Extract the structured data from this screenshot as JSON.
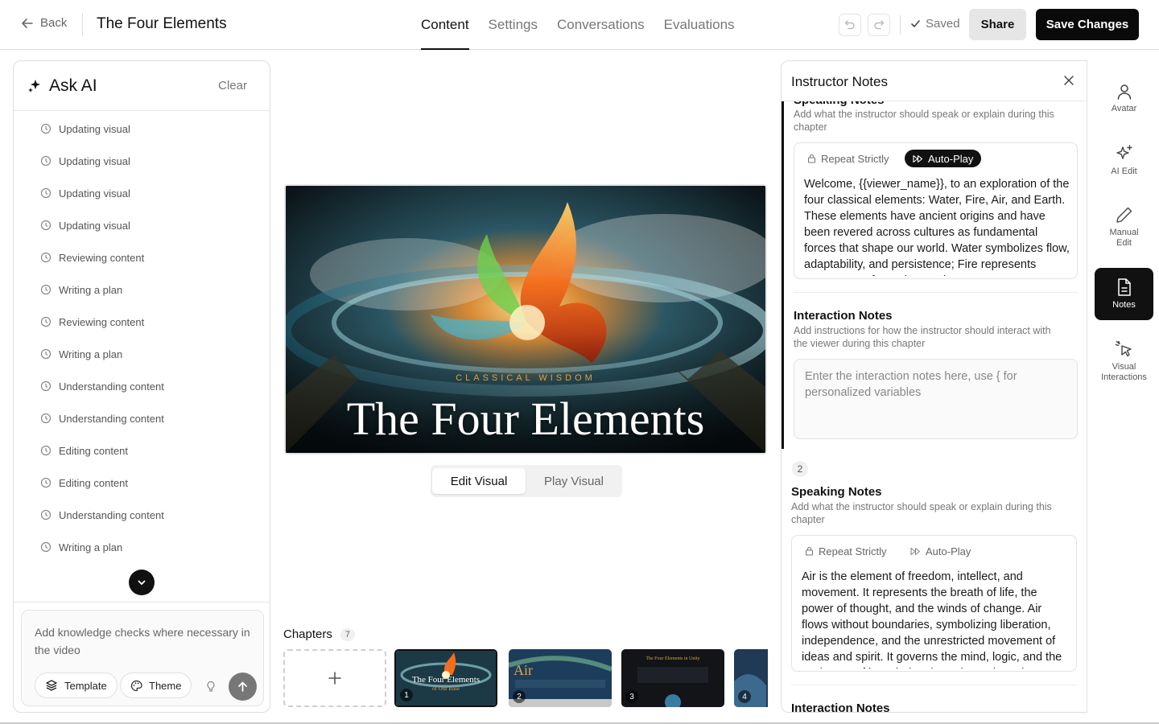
{
  "topbar": {
    "back_label": "Back",
    "course_title": "The Four Elements",
    "tabs": [
      {
        "label": "Content",
        "active": true
      },
      {
        "label": "Settings",
        "active": false
      },
      {
        "label": "Conversations",
        "active": false
      },
      {
        "label": "Evaluations",
        "active": false
      }
    ],
    "saved_label": "Saved",
    "share_label": "Share",
    "save_label": "Save Changes"
  },
  "ask_ai": {
    "title": "Ask AI",
    "clear_label": "Clear",
    "items": [
      "Updating visual",
      "Updating visual",
      "Updating visual",
      "Updating visual",
      "Reviewing content",
      "Writing a plan",
      "Reviewing content",
      "Writing a plan",
      "Understanding content",
      "Understanding content",
      "Editing content",
      "Editing content",
      "Understanding content",
      "Writing a plan"
    ],
    "input_placeholder": "Add knowledge checks where necessary in the video",
    "template_label": "Template",
    "theme_label": "Theme"
  },
  "preview": {
    "eyebrow": "CLASSICAL WISDOM",
    "title": "The Four Elements",
    "edit_visual_label": "Edit Visual",
    "play_visual_label": "Play Visual"
  },
  "chapters": {
    "label": "Chapters",
    "count": "7",
    "thumbnails": [
      {
        "number": "1",
        "title": "The Four Elements",
        "subtitle": "of Our Base",
        "selected": true
      },
      {
        "number": "2",
        "title": "Air",
        "subtitle": "",
        "selected": false
      },
      {
        "number": "3",
        "title": "The Four Elements in Unity",
        "subtitle": "",
        "selected": false
      },
      {
        "number": "4",
        "title": "",
        "subtitle": "",
        "selected": false
      }
    ]
  },
  "notes": {
    "title": "Instructor Notes",
    "chapter1": {
      "speaking_label": "Speaking Notes",
      "speaking_sub": "Add what the instructor should speak or explain during this chapter",
      "repeat_label": "Repeat Strictly",
      "autoplay_label": "Auto-Play",
      "speaking_text": "Welcome, {{viewer_name}}, to an exploration of the four classical elements: Water, Fire, Air, and Earth. These elements have ancient origins and have been revered across cultures as fundamental forces that shape our world. Water symbolizes flow, adaptability, and persistence; Fire represents energy, transformation, and",
      "interaction_label": "Interaction Notes",
      "interaction_sub": "Add instructions for how the instructor should interact with the viewer during this chapter",
      "interaction_placeholder": "Enter the interaction notes here, use { for personalized variables"
    },
    "chapter2": {
      "number": "2",
      "speaking_label": "Speaking Notes",
      "speaking_sub": "Add what the instructor should speak or explain during this chapter",
      "repeat_label": "Repeat Strictly",
      "autoplay_label": "Auto-Play",
      "speaking_text": "Air is the element of freedom, intellect, and movement. It represents the breath of life, the power of thought, and the winds of change. Air flows without boundaries, symbolizing liberation, independence, and the unrestricted movement of ideas and spirit. It governs the mind, logic, and the exchange of knowledge through words and",
      "interaction_label": "Interaction Notes"
    }
  },
  "sidebar": {
    "items": [
      {
        "label": "Avatar",
        "icon": "person-icon",
        "active": false
      },
      {
        "label": "AI Edit",
        "icon": "sparkle-icon",
        "active": false
      },
      {
        "label": "Manual Edit",
        "icon": "pencil-icon",
        "active": false
      },
      {
        "label": "Notes",
        "icon": "document-icon",
        "active": true
      },
      {
        "label": "Visual Interactions",
        "icon": "cursor-click-icon",
        "active": false
      }
    ]
  },
  "colors": {
    "primary": "#0a0a0a",
    "muted_text": "#777777",
    "border": "#dddddd",
    "accent_gold": "#e0a040"
  }
}
